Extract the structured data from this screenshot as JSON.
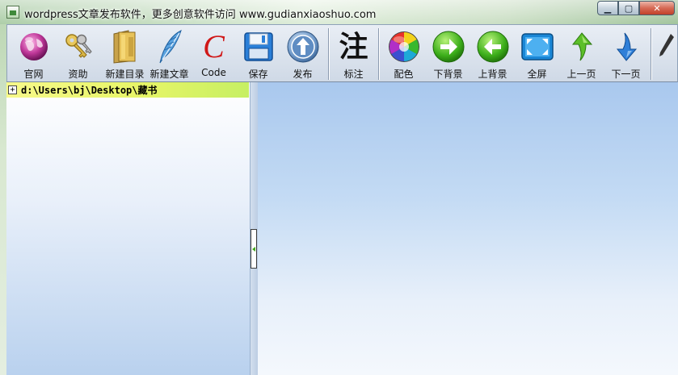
{
  "window": {
    "title": "wordpress文章发布软件，更多创意软件访问 www.gudianxiaoshuo.com",
    "minimize_label": "▁",
    "maximize_label": "▢",
    "close_label": "✕"
  },
  "toolbar": {
    "items": [
      {
        "label": "官网",
        "icon": "globe-icon"
      },
      {
        "label": "资助",
        "icon": "keys-icon"
      },
      {
        "label": "新建目录",
        "icon": "folder-icon"
      },
      {
        "label": "新建文章",
        "icon": "feather-icon"
      },
      {
        "label": "Code",
        "icon": "code-c-icon"
      },
      {
        "label": "保存",
        "icon": "floppy-icon"
      },
      {
        "label": "发布",
        "icon": "publish-arrow-icon"
      },
      {
        "label": "标注",
        "icon": "annotate-char-icon",
        "glyph": "注"
      },
      {
        "label": "配色",
        "icon": "color-wheel-icon"
      },
      {
        "label": "下背景",
        "icon": "next-background-icon"
      },
      {
        "label": "上背景",
        "icon": "previous-background-icon"
      },
      {
        "label": "全屏",
        "icon": "fullscreen-icon"
      },
      {
        "label": "上一页",
        "icon": "page-up-icon"
      },
      {
        "label": "下一页",
        "icon": "page-down-icon"
      }
    ]
  },
  "tree": {
    "expander": "+",
    "root_path": "d:\\Users\\bj\\Desktop\\藏书"
  },
  "colors": {
    "tree_highlight": "#e7f567",
    "editor_background": "#c4dbf4",
    "accent_green": "#3cae1a"
  }
}
